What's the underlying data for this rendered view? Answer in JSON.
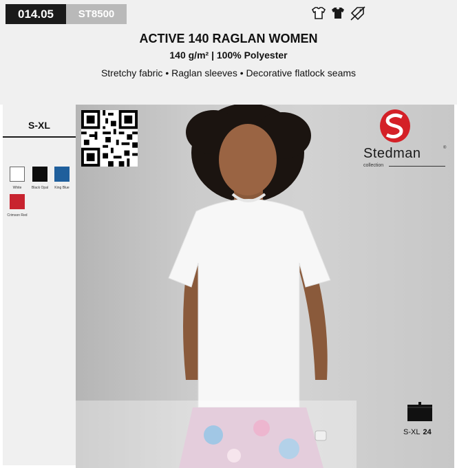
{
  "header": {
    "code": "014.05",
    "sku": "ST8500",
    "icons": [
      "tshirt-outline-icon",
      "tshirt-filled-icon",
      "no-discount-icon"
    ],
    "title": "ACTIVE 140 RAGLAN WOMEN",
    "subtitle": "140 g/m² | 100% Polyester",
    "features": "Stretchy fabric • Raglan sleeves • Decorative flatlock seams"
  },
  "sidebar": {
    "size_range": "S-XL",
    "colors": [
      {
        "name": "White",
        "hex": "#ffffff"
      },
      {
        "name": "Black Opal",
        "hex": "#0d0d0d"
      },
      {
        "name": "King Blue",
        "hex": "#1f5f9c"
      },
      {
        "name": "Crimson Red",
        "hex": "#c8232f"
      }
    ]
  },
  "brand": {
    "name": "Stedman",
    "reg": "®",
    "tagline": "collection",
    "accent": "#d42027"
  },
  "packaging": {
    "size": "S-XL",
    "quantity": "24"
  }
}
